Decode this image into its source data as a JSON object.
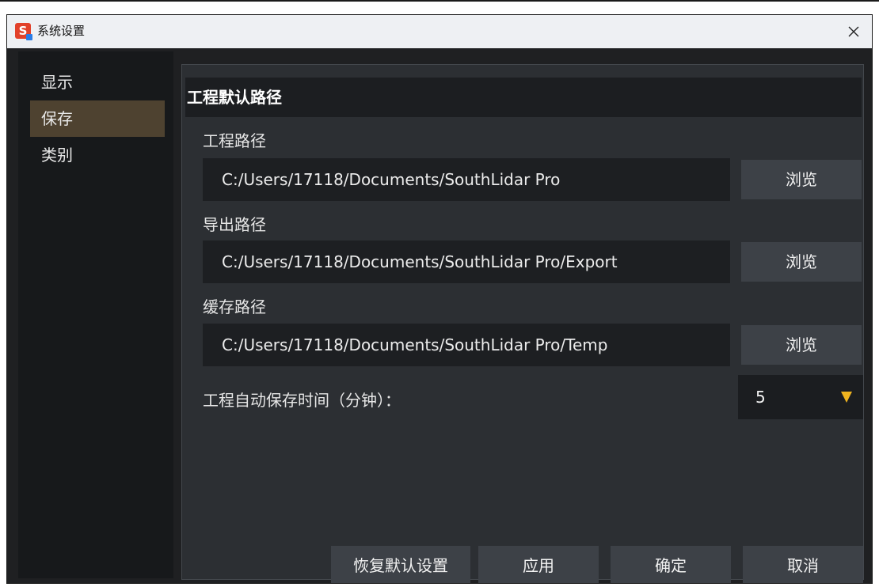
{
  "window": {
    "title": "系统设置",
    "icon_letter": "S",
    "close_icon": "close-icon"
  },
  "sidebar": {
    "items": [
      {
        "label": "显示",
        "active": false
      },
      {
        "label": "保存",
        "active": true
      },
      {
        "label": "类别",
        "active": false
      }
    ]
  },
  "panel": {
    "section_title": "工程默认路径",
    "fields": [
      {
        "label": "工程路径",
        "value": "C:/Users/17118/Documents/SouthLidar Pro",
        "browse_label": "浏览"
      },
      {
        "label": "导出路径",
        "value": "C:/Users/17118/Documents/SouthLidar Pro/Export",
        "browse_label": "浏览"
      },
      {
        "label": "缓存路径",
        "value": "C:/Users/17118/Documents/SouthLidar Pro/Temp",
        "browse_label": "浏览"
      }
    ],
    "autosave": {
      "label": "工程自动保存时间（分钟）：",
      "value": "5"
    }
  },
  "footer": {
    "restore_label": "恢复默认设置",
    "apply_label": "应用",
    "ok_label": "确定",
    "cancel_label": "取消"
  },
  "colors": {
    "accent": "#f0b41f",
    "active_item": "#4e4230",
    "panel_bg": "#2c2f33",
    "window_bg": "#1f2022"
  }
}
